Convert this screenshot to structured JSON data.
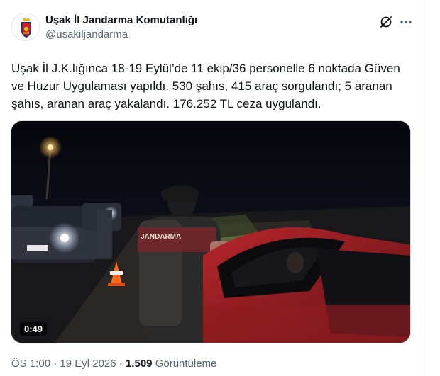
{
  "account": {
    "display_name": "Uşak İl Jandarma Komutanlığı",
    "handle": "@usakiljandarma",
    "avatar_icon": "gendarmerie-emblem-icon"
  },
  "actions": {
    "grok_icon": "grok-icon",
    "more_icon": "more-dots-icon"
  },
  "tweet": {
    "text": "Uşak İl J.K.lığınca 18-19 Eylül’de 11 ekip/36 personelle 6 noktada Güven ve Huzur Uygulaması yapıldı. 530 şahıs, 415 araç sorgulandı; 5 aranan şahıs, aranan araç yakalandı. 176.252 TL ceza uygulandı."
  },
  "media": {
    "duration": "0:49",
    "vest_text": "JANDARMA"
  },
  "meta": {
    "time": "ÖS 1:00",
    "separator": "·",
    "date": "19 Eyl 2026",
    "views_count": "1.509",
    "views_label": "Görüntüleme"
  }
}
